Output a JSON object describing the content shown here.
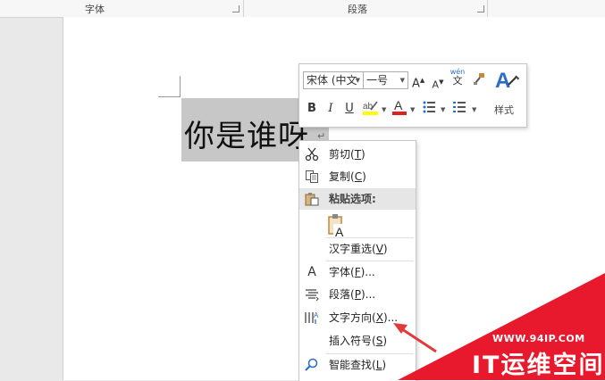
{
  "ribbon": {
    "groups": [
      {
        "label": "字体"
      },
      {
        "label": "段落"
      }
    ]
  },
  "document": {
    "text": "你是谁呀",
    "paragraph_mark": "↵"
  },
  "mini_toolbar": {
    "font_name": "宋体 (中文",
    "font_size": "一号",
    "grow_font": "A",
    "shrink_font": "A",
    "phonetic_top": "wén",
    "phonetic_bottom": "文",
    "bold": "B",
    "italic": "I",
    "underline": "U",
    "font_color": "A",
    "styles_label": "样式",
    "highlight_color": "#ffff00",
    "font_color_value": "#e02020",
    "styles_accent": "#2b6cc4"
  },
  "context_menu": {
    "items": [
      {
        "label": "剪切",
        "key": "T"
      },
      {
        "label": "复制",
        "key": "C"
      },
      {
        "label": "粘贴选项:"
      },
      {
        "label": "汉字重选",
        "key": "V"
      },
      {
        "label": "字体",
        "key": "F",
        "suffix": "..."
      },
      {
        "label": "段落",
        "key": "P",
        "suffix": "..."
      },
      {
        "label": "文字方向",
        "key": "X",
        "suffix": "..."
      },
      {
        "label": "插入符号",
        "key": "S"
      },
      {
        "label": "智能查找",
        "key": "L"
      }
    ],
    "font_icon": "A",
    "paste_icon_letter": "A"
  },
  "watermark": {
    "url": "WWW.94IP.COM",
    "brand": "IT运维空间",
    "color": "#e8192c"
  },
  "colors": {
    "arrow": "#e03a3a",
    "selection": "#c7c7c7"
  }
}
